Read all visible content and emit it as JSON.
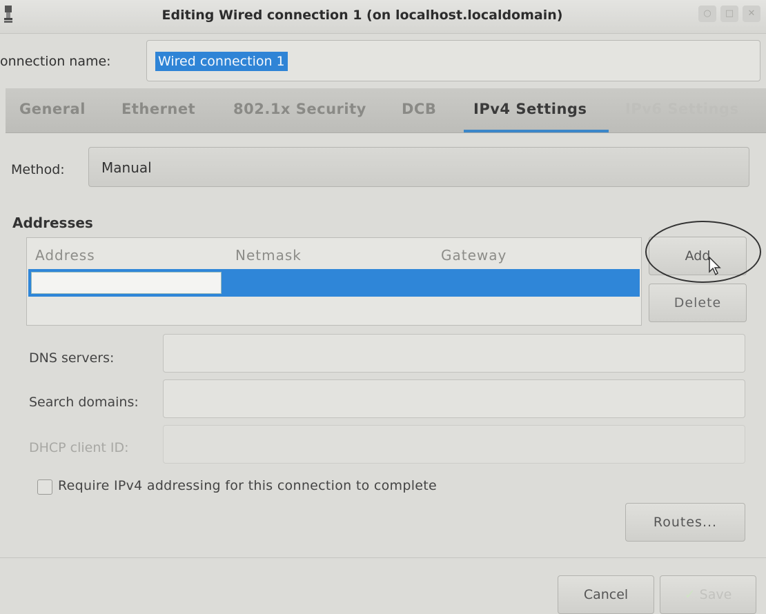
{
  "window": {
    "title": "Editing Wired connection 1 (on localhost.localdomain)",
    "controls": [
      "minimize-icon",
      "maximize-icon",
      "close-icon"
    ]
  },
  "connection": {
    "label": "onnection name:",
    "value": "Wired connection 1"
  },
  "tabs": [
    {
      "label": "General",
      "state": "normal"
    },
    {
      "label": "Ethernet",
      "state": "normal"
    },
    {
      "label": "802.1x Security",
      "state": "normal"
    },
    {
      "label": "DCB",
      "state": "normal"
    },
    {
      "label": "IPv4 Settings",
      "state": "active"
    },
    {
      "label": "IPv6 Settings",
      "state": "disabled"
    }
  ],
  "method": {
    "label": "Method:",
    "value": "Manual"
  },
  "addresses": {
    "heading": "Addresses",
    "columns": [
      "Address",
      "Netmask",
      "Gateway"
    ],
    "rows": [
      {
        "address": "",
        "netmask": "",
        "gateway": ""
      }
    ],
    "add_label": "Add",
    "delete_label": "Delete"
  },
  "fields": {
    "dns_label": "DNS servers:",
    "dns_value": "",
    "search_label": "Search domains:",
    "search_value": "",
    "dhcp_label": "DHCP client ID:",
    "dhcp_value": ""
  },
  "require_ipv4": {
    "label": "Require IPv4 addressing for this connection to complete",
    "checked": false
  },
  "routes_label": "Routes...",
  "footer": {
    "cancel_label": "Cancel",
    "save_label": "Save"
  },
  "colors": {
    "accent": "#2f86d8",
    "tab_underline": "#3b86c8",
    "background": "#dcdcd8"
  }
}
